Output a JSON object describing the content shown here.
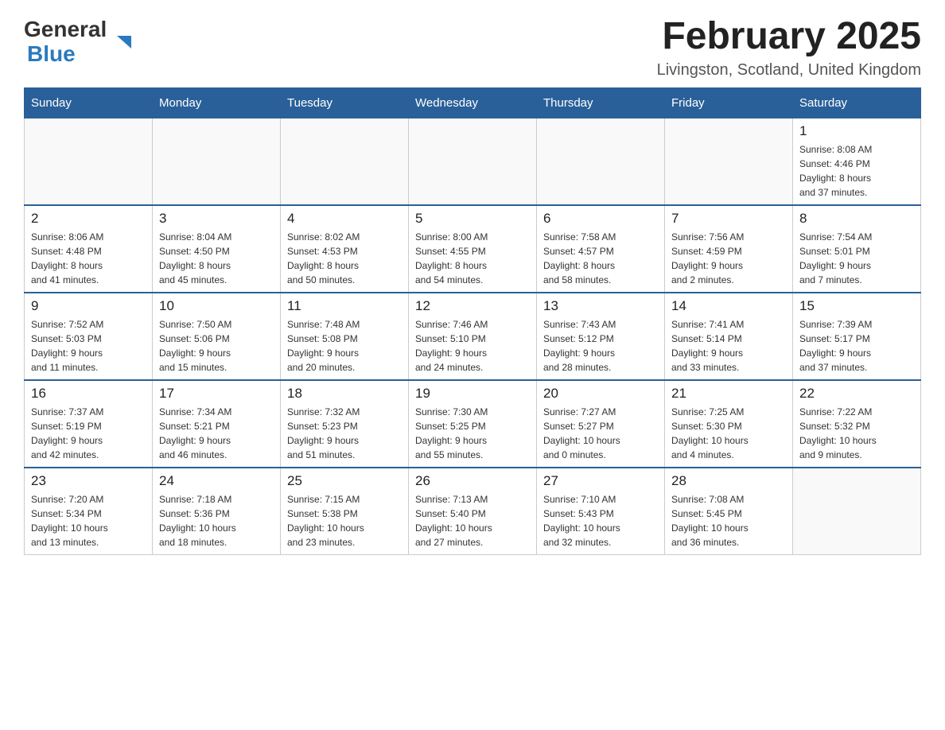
{
  "header": {
    "logo_general": "General",
    "logo_blue": "Blue",
    "title": "February 2025",
    "subtitle": "Livingston, Scotland, United Kingdom"
  },
  "days_of_week": [
    "Sunday",
    "Monday",
    "Tuesday",
    "Wednesday",
    "Thursday",
    "Friday",
    "Saturday"
  ],
  "weeks": [
    {
      "days": [
        {
          "num": "",
          "info": ""
        },
        {
          "num": "",
          "info": ""
        },
        {
          "num": "",
          "info": ""
        },
        {
          "num": "",
          "info": ""
        },
        {
          "num": "",
          "info": ""
        },
        {
          "num": "",
          "info": ""
        },
        {
          "num": "1",
          "info": "Sunrise: 8:08 AM\nSunset: 4:46 PM\nDaylight: 8 hours\nand 37 minutes."
        }
      ]
    },
    {
      "days": [
        {
          "num": "2",
          "info": "Sunrise: 8:06 AM\nSunset: 4:48 PM\nDaylight: 8 hours\nand 41 minutes."
        },
        {
          "num": "3",
          "info": "Sunrise: 8:04 AM\nSunset: 4:50 PM\nDaylight: 8 hours\nand 45 minutes."
        },
        {
          "num": "4",
          "info": "Sunrise: 8:02 AM\nSunset: 4:53 PM\nDaylight: 8 hours\nand 50 minutes."
        },
        {
          "num": "5",
          "info": "Sunrise: 8:00 AM\nSunset: 4:55 PM\nDaylight: 8 hours\nand 54 minutes."
        },
        {
          "num": "6",
          "info": "Sunrise: 7:58 AM\nSunset: 4:57 PM\nDaylight: 8 hours\nand 58 minutes."
        },
        {
          "num": "7",
          "info": "Sunrise: 7:56 AM\nSunset: 4:59 PM\nDaylight: 9 hours\nand 2 minutes."
        },
        {
          "num": "8",
          "info": "Sunrise: 7:54 AM\nSunset: 5:01 PM\nDaylight: 9 hours\nand 7 minutes."
        }
      ]
    },
    {
      "days": [
        {
          "num": "9",
          "info": "Sunrise: 7:52 AM\nSunset: 5:03 PM\nDaylight: 9 hours\nand 11 minutes."
        },
        {
          "num": "10",
          "info": "Sunrise: 7:50 AM\nSunset: 5:06 PM\nDaylight: 9 hours\nand 15 minutes."
        },
        {
          "num": "11",
          "info": "Sunrise: 7:48 AM\nSunset: 5:08 PM\nDaylight: 9 hours\nand 20 minutes."
        },
        {
          "num": "12",
          "info": "Sunrise: 7:46 AM\nSunset: 5:10 PM\nDaylight: 9 hours\nand 24 minutes."
        },
        {
          "num": "13",
          "info": "Sunrise: 7:43 AM\nSunset: 5:12 PM\nDaylight: 9 hours\nand 28 minutes."
        },
        {
          "num": "14",
          "info": "Sunrise: 7:41 AM\nSunset: 5:14 PM\nDaylight: 9 hours\nand 33 minutes."
        },
        {
          "num": "15",
          "info": "Sunrise: 7:39 AM\nSunset: 5:17 PM\nDaylight: 9 hours\nand 37 minutes."
        }
      ]
    },
    {
      "days": [
        {
          "num": "16",
          "info": "Sunrise: 7:37 AM\nSunset: 5:19 PM\nDaylight: 9 hours\nand 42 minutes."
        },
        {
          "num": "17",
          "info": "Sunrise: 7:34 AM\nSunset: 5:21 PM\nDaylight: 9 hours\nand 46 minutes."
        },
        {
          "num": "18",
          "info": "Sunrise: 7:32 AM\nSunset: 5:23 PM\nDaylight: 9 hours\nand 51 minutes."
        },
        {
          "num": "19",
          "info": "Sunrise: 7:30 AM\nSunset: 5:25 PM\nDaylight: 9 hours\nand 55 minutes."
        },
        {
          "num": "20",
          "info": "Sunrise: 7:27 AM\nSunset: 5:27 PM\nDaylight: 10 hours\nand 0 minutes."
        },
        {
          "num": "21",
          "info": "Sunrise: 7:25 AM\nSunset: 5:30 PM\nDaylight: 10 hours\nand 4 minutes."
        },
        {
          "num": "22",
          "info": "Sunrise: 7:22 AM\nSunset: 5:32 PM\nDaylight: 10 hours\nand 9 minutes."
        }
      ]
    },
    {
      "days": [
        {
          "num": "23",
          "info": "Sunrise: 7:20 AM\nSunset: 5:34 PM\nDaylight: 10 hours\nand 13 minutes."
        },
        {
          "num": "24",
          "info": "Sunrise: 7:18 AM\nSunset: 5:36 PM\nDaylight: 10 hours\nand 18 minutes."
        },
        {
          "num": "25",
          "info": "Sunrise: 7:15 AM\nSunset: 5:38 PM\nDaylight: 10 hours\nand 23 minutes."
        },
        {
          "num": "26",
          "info": "Sunrise: 7:13 AM\nSunset: 5:40 PM\nDaylight: 10 hours\nand 27 minutes."
        },
        {
          "num": "27",
          "info": "Sunrise: 7:10 AM\nSunset: 5:43 PM\nDaylight: 10 hours\nand 32 minutes."
        },
        {
          "num": "28",
          "info": "Sunrise: 7:08 AM\nSunset: 5:45 PM\nDaylight: 10 hours\nand 36 minutes."
        },
        {
          "num": "",
          "info": ""
        }
      ]
    }
  ]
}
